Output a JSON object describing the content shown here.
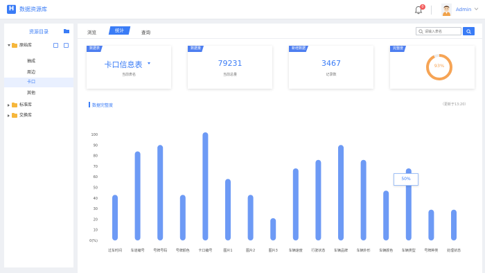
{
  "header": {
    "logo_letter": "H",
    "app_title": "数据资源库",
    "notification_count": "0",
    "user_name": "Admin"
  },
  "sidebar": {
    "title": "资源目录",
    "tree": [
      {
        "label": "原始库",
        "expanded": true,
        "children": [
          {
            "label": "抽成",
            "selected": false
          },
          {
            "label": "周边",
            "selected": false
          },
          {
            "label": "卡口",
            "selected": true
          },
          {
            "label": "其他",
            "selected": false
          }
        ]
      },
      {
        "label": "标准库",
        "expanded": false
      },
      {
        "label": "交换库",
        "expanded": false
      }
    ]
  },
  "tabs": [
    {
      "label": "浏览",
      "active": false
    },
    {
      "label": "统计",
      "active": true
    },
    {
      "label": "查询",
      "active": false
    }
  ],
  "search": {
    "placeholder": "请输入表名"
  },
  "cards": {
    "table": {
      "tag": "数据表",
      "value": "卡口信息表",
      "sub": "当前表名"
    },
    "records_now": {
      "tag": "数据量",
      "value": "79231",
      "sub": "当前总量"
    },
    "records_new": {
      "tag": "新增数据",
      "value": "3467",
      "sub": "记录数"
    },
    "completeness": {
      "tag": "完整度",
      "value": "93%",
      "percent": 93,
      "color": "#f6a455"
    }
  },
  "chart_title": "数据完整度",
  "chart_updated": "（更新于13:20）",
  "tooltip": "50%",
  "chart_data": {
    "type": "bar",
    "title": "数据完整度",
    "ylabel": "0(%)",
    "ylim": [
      0,
      100
    ],
    "yticks": [
      "0(%)",
      "10",
      "20",
      "30",
      "40",
      "50",
      "60",
      "70",
      "80",
      "90",
      "100"
    ],
    "categories": [
      "过车时间",
      "车道编号",
      "号牌号码",
      "号牌颜色",
      "卡口编号",
      "图片1",
      "图片2",
      "图片3",
      "车辆速度",
      "行驶状态",
      "车辆品牌",
      "车辆外形",
      "车辆颜色",
      "车辆类型",
      "号牌种类",
      "处理状态"
    ],
    "values": [
      43,
      84,
      90,
      43,
      102,
      58,
      43,
      21,
      68,
      76,
      90,
      76,
      47,
      68,
      29,
      29
    ],
    "bar_color": "#6d9af5",
    "grid": false
  }
}
